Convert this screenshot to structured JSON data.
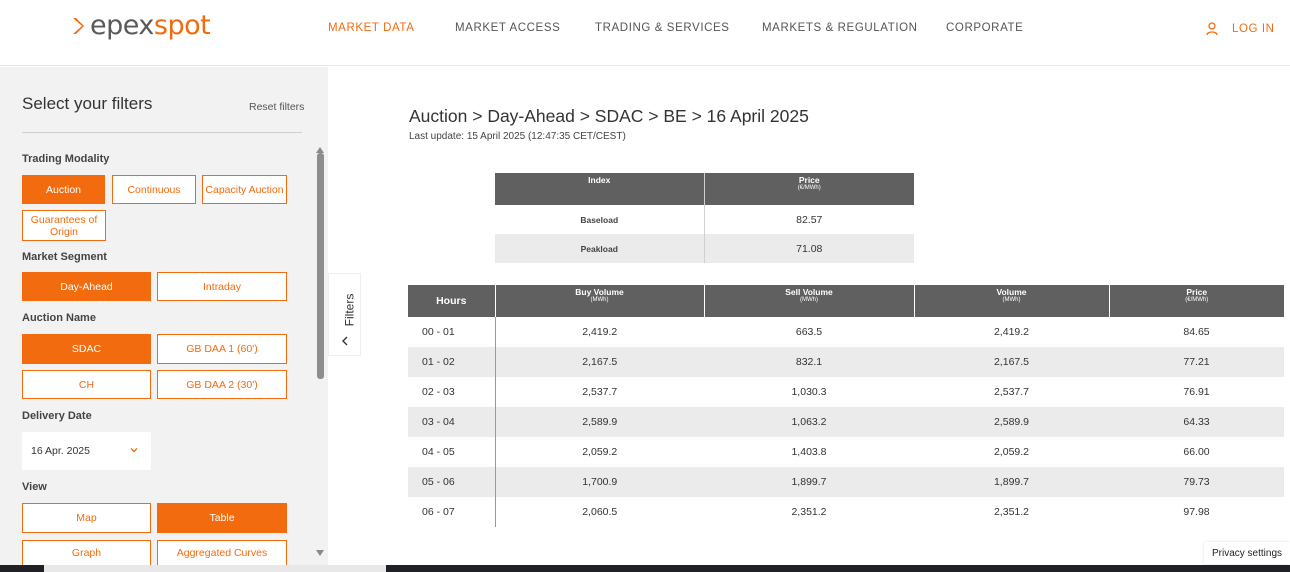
{
  "brand": {
    "part1": "epex",
    "part2": "spot",
    "accent": "#f26b0f"
  },
  "nav": {
    "items": [
      "MARKET DATA",
      "MARKET ACCESS",
      "TRADING & SERVICES",
      "MARKETS & REGULATION",
      "CORPORATE"
    ],
    "active": "MARKET DATA",
    "login": "LOG IN"
  },
  "sidebar": {
    "title": "Select your filters",
    "reset": "Reset filters",
    "trading_modality": {
      "label": "Trading Modality",
      "options": [
        "Auction",
        "Continuous",
        "Capacity Auction",
        "Guarantees of Origin"
      ],
      "selected": "Auction"
    },
    "market_segment": {
      "label": "Market Segment",
      "options": [
        "Day-Ahead",
        "Intraday"
      ],
      "selected": "Day-Ahead"
    },
    "auction_name": {
      "label": "Auction Name",
      "options": [
        "SDAC",
        "GB DAA 1 (60')",
        "CH",
        "GB DAA 2 (30')"
      ],
      "selected": "SDAC"
    },
    "delivery_date": {
      "label": "Delivery Date",
      "value": "16 Apr. 2025"
    },
    "view": {
      "label": "View",
      "options": [
        "Map",
        "Table",
        "Graph",
        "Aggregated Curves"
      ],
      "selected": "Table"
    },
    "collapse_label": "Filters"
  },
  "main": {
    "breadcrumb": "Auction > Day-Ahead > SDAC > BE > 16 April 2025",
    "last_update": "Last update: 15 April 2025 (12:47:35 CET/CEST)",
    "index_table": {
      "headers": [
        {
          "label": "Index",
          "unit": ""
        },
        {
          "label": "Price",
          "unit": "(€/MWh)"
        }
      ],
      "rows": [
        [
          "Baseload",
          "82.57"
        ],
        [
          "Peakload",
          "71.08"
        ]
      ]
    },
    "hours_table": {
      "headers": [
        {
          "label": "Hours",
          "unit": ""
        },
        {
          "label": "Buy Volume",
          "unit": "(MWh)"
        },
        {
          "label": "Sell Volume",
          "unit": "(MWh)"
        },
        {
          "label": "Volume",
          "unit": "(MWh)"
        },
        {
          "label": "Price",
          "unit": "(€/MWh)"
        }
      ],
      "rows": [
        [
          "00 - 01",
          "2,419.2",
          "663.5",
          "2,419.2",
          "84.65"
        ],
        [
          "01 - 02",
          "2,167.5",
          "832.1",
          "2,167.5",
          "77.21"
        ],
        [
          "02 - 03",
          "2,537.7",
          "1,030.3",
          "2,537.7",
          "76.91"
        ],
        [
          "03 - 04",
          "2,589.9",
          "1,063.2",
          "2,589.9",
          "64.33"
        ],
        [
          "04 - 05",
          "2,059.2",
          "1,403.8",
          "2,059.2",
          "66.00"
        ],
        [
          "05 - 06",
          "1,700.9",
          "1,899.7",
          "1,899.7",
          "79.73"
        ],
        [
          "06 - 07",
          "2,060.5",
          "2,351.2",
          "2,351.2",
          "97.98"
        ]
      ]
    }
  },
  "privacy": "Privacy settings"
}
